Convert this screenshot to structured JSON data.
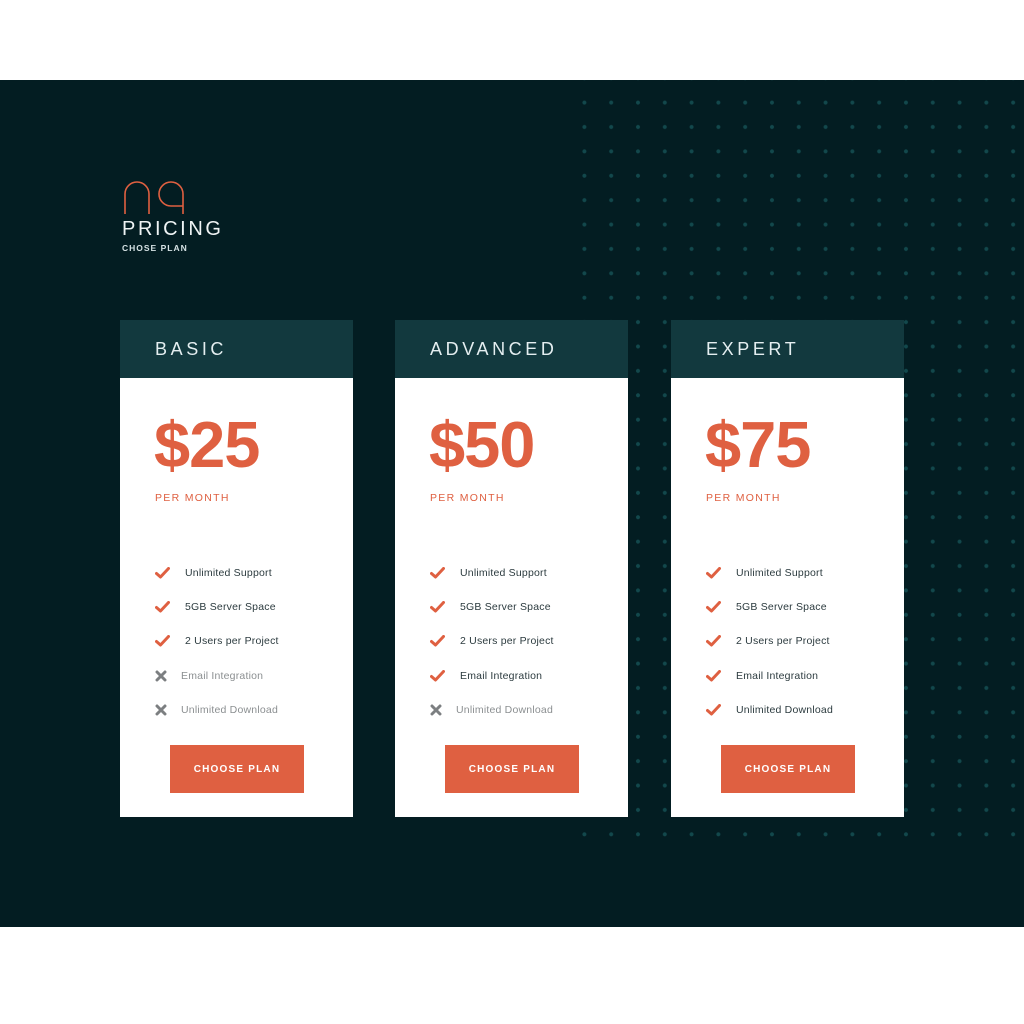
{
  "brand": {
    "logo_icon": "na-monogram-icon",
    "title": "PRICING",
    "subtitle": "CHOSE PLAN"
  },
  "colors": {
    "background_dark": "#031d22",
    "card_header": "#12393e",
    "accent": "#df6041",
    "dot_grid": "#12484c"
  },
  "plans": [
    {
      "name": "BASIC",
      "price": "$25",
      "period": "PER MONTH",
      "features": [
        {
          "label": "Unlimited Support",
          "included": true
        },
        {
          "label": "5GB Server Space",
          "included": true
        },
        {
          "label": "2 Users per Project",
          "included": true
        },
        {
          "label": "Email Integration",
          "included": false
        },
        {
          "label": "Unlimited Download",
          "included": false
        }
      ],
      "button": "CHOOSE PLAN"
    },
    {
      "name": "ADVANCED",
      "price": "$50",
      "period": "PER MONTH",
      "features": [
        {
          "label": "Unlimited Support",
          "included": true
        },
        {
          "label": "5GB Server Space",
          "included": true
        },
        {
          "label": "2 Users per Project",
          "included": true
        },
        {
          "label": "Email Integration",
          "included": true
        },
        {
          "label": "Unlimited Download",
          "included": false
        }
      ],
      "button": "CHOOSE PLAN"
    },
    {
      "name": "EXPERT",
      "price": "$75",
      "period": "PER MONTH",
      "features": [
        {
          "label": "Unlimited Support",
          "included": true
        },
        {
          "label": "5GB Server Space",
          "included": true
        },
        {
          "label": "2 Users per Project",
          "included": true
        },
        {
          "label": "Email Integration",
          "included": true
        },
        {
          "label": "Unlimited Download",
          "included": true
        }
      ],
      "button": "CHOOSE PLAN"
    }
  ],
  "icons": {
    "included": "check-icon",
    "excluded": "cross-icon"
  }
}
